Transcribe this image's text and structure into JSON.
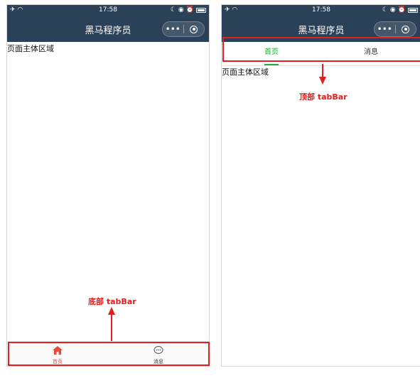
{
  "status_bar": {
    "time": "17:58"
  },
  "nav": {
    "title": "黑马程序员",
    "more_label": "•••"
  },
  "main": {
    "text": "页面主体区域"
  },
  "bottom_tabs": [
    {
      "label": "首页",
      "icon": "home-icon",
      "color": "#e64b3c"
    },
    {
      "label": "消息",
      "icon": "message-icon",
      "color": "#333333"
    }
  ],
  "top_tabs": [
    {
      "label": "首页",
      "color": "#22ac38"
    },
    {
      "label": "消息",
      "color": "#333333"
    }
  ],
  "annotations": {
    "bottom": "底部 tabBar",
    "top": "顶部 tabBar"
  },
  "colors": {
    "navbar": "#2b4157",
    "highlight": "#e02020"
  }
}
